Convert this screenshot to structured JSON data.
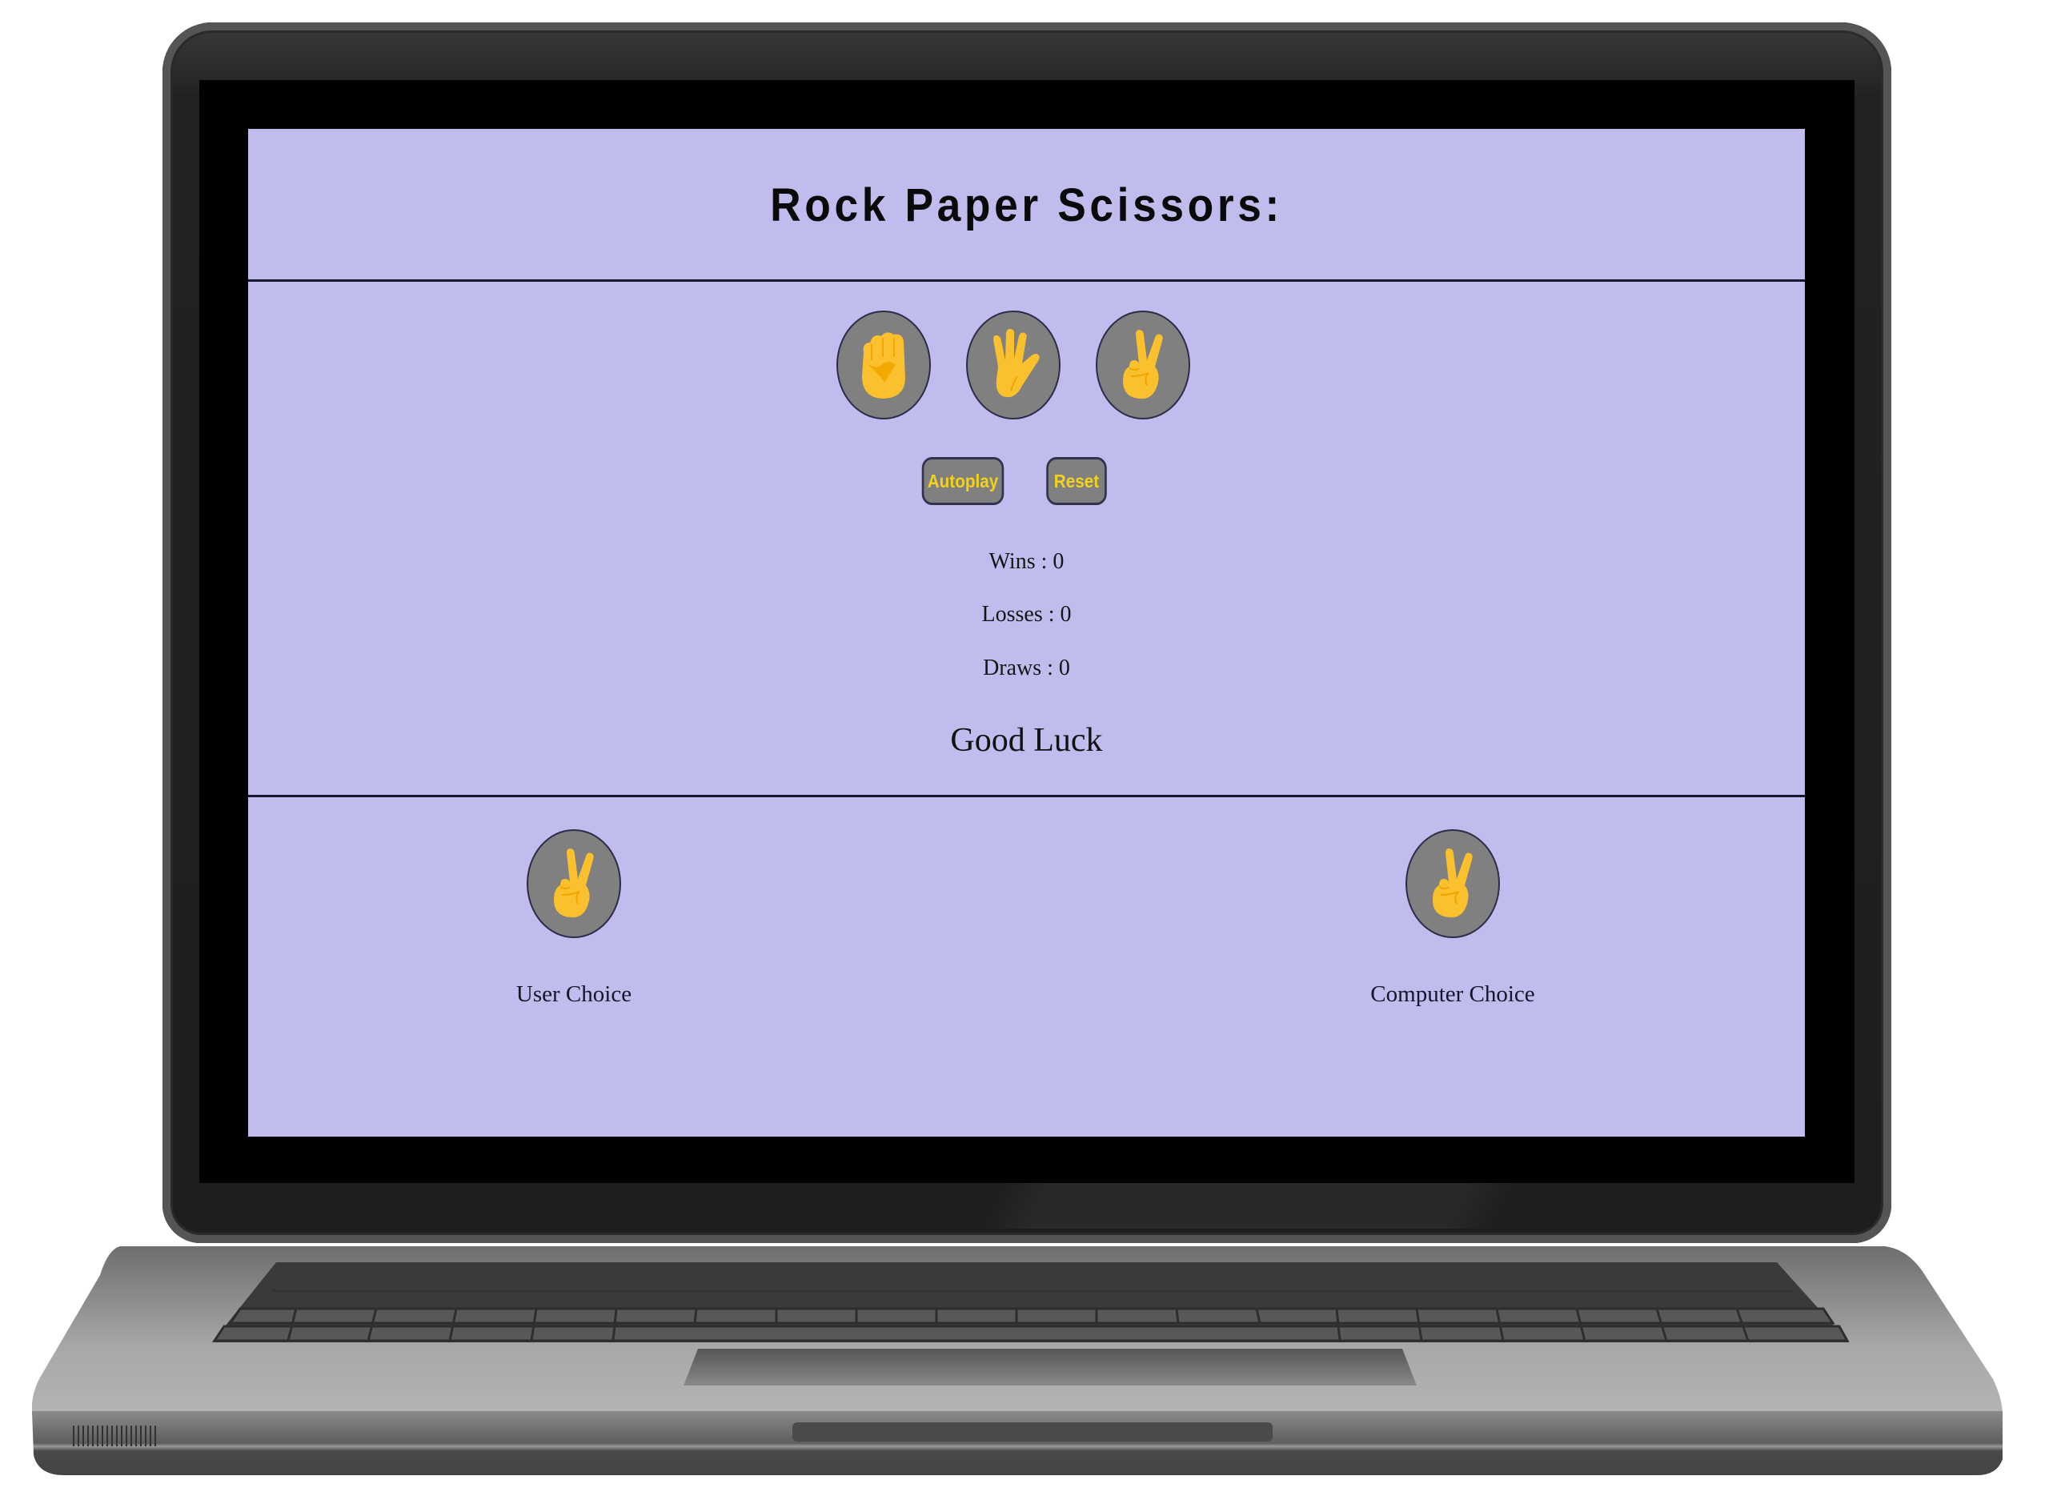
{
  "app": {
    "title": "Rock Paper Scissors:"
  },
  "moves": [
    {
      "id": "rock",
      "icon": "raised-fist-icon"
    },
    {
      "id": "paper",
      "icon": "raised-hand-icon"
    },
    {
      "id": "scissors",
      "icon": "victory-hand-icon"
    }
  ],
  "controls": {
    "autoplay_label": "Autoplay",
    "reset_label": "Reset"
  },
  "score": {
    "wins": "Wins : 0",
    "losses": "Losses : 0",
    "draws": "Draws : 0"
  },
  "result_text": "Good Luck",
  "picks": {
    "user": {
      "label": "User Choice",
      "icon": "victory-hand-icon"
    },
    "computer": {
      "label": "Computer Choice",
      "icon": "victory-hand-icon"
    }
  },
  "colors": {
    "page_bg": "#c0bcee",
    "button_bg": "#808080",
    "button_text": "#f2d21c",
    "emoji_yellow": "#fbc02d"
  }
}
